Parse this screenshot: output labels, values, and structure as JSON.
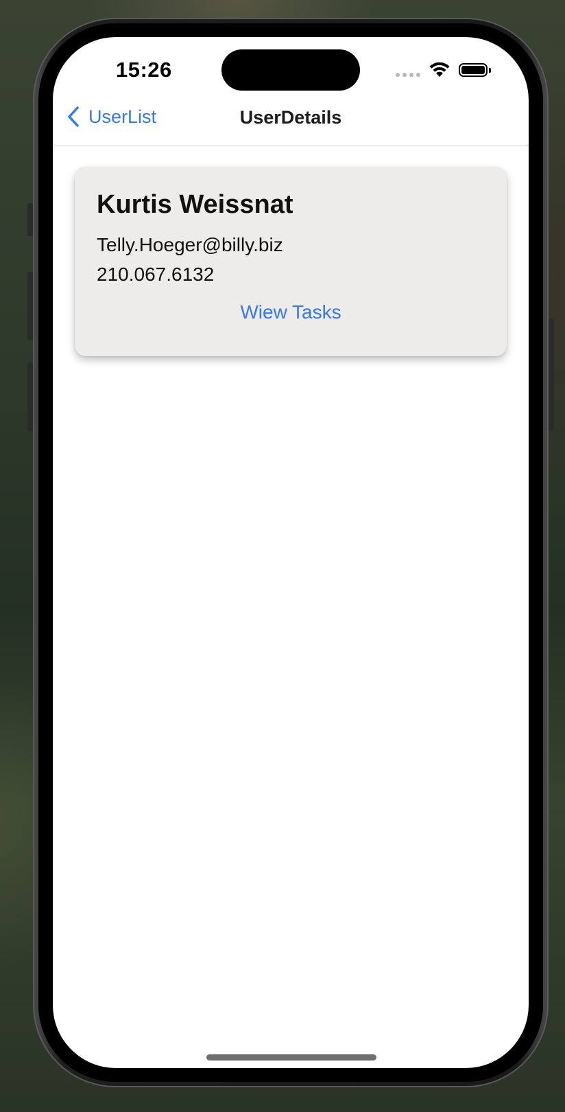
{
  "status_bar": {
    "time": "15:26",
    "wifi_icon": "wifi-icon",
    "battery_icon": "battery-icon"
  },
  "nav": {
    "back_label": "UserList",
    "back_icon": "chevron-left-icon",
    "title": "UserDetails"
  },
  "user": {
    "name": "Kurtis Weissnat",
    "email": "Telly.Hoeger@billy.biz",
    "phone": "210.067.6132",
    "tasks_button_label": "Wiew Tasks"
  },
  "colors": {
    "accent": "#3478f6",
    "card_background": "#edeceb"
  }
}
